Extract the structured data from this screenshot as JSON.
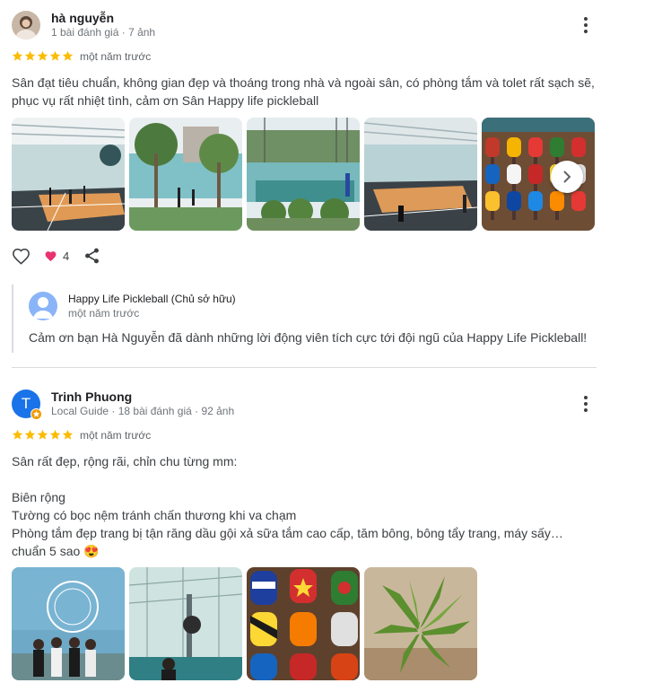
{
  "review1": {
    "author": "hà nguyễn",
    "meta": "1 bài đánh giá · 7 ảnh",
    "rating": 5,
    "time": "một năm trước",
    "text_line1": "Sân đạt tiêu chuẩn, không gian đẹp và thoáng trong nhà và ngoài sân, có phòng tắm và tolet rất sạch sẽ,",
    "text_line2": "phục vụ rất nhiệt tình, cảm ơn Sân Happy life pickleball",
    "like_count": "4",
    "owner_response": {
      "name": "Happy Life Pickleball (Chủ sở hữu)",
      "time": "một năm trước",
      "text": "Cảm ơn bạn Hà Nguyễn đã dành những lời động viên tích cực tới đội ngũ của Happy Life Pickleball!"
    }
  },
  "review2": {
    "avatar_letter": "T",
    "author": "Trinh Phuong",
    "meta": "Local Guide · 18 bài đánh giá · 92 ảnh",
    "rating": 5,
    "time": "một năm trước",
    "lines": [
      "Sân rất đẹp, rộng rãi, chỉn chu từng mm:",
      "",
      "Biên rộng",
      "Tường có bọc nệm tránh chấn thương khi va chạm",
      "Phòng tắm đẹp trang bị tận răng dầu gội xả sữa tắm cao cấp, tăm bông, bông tẩy trang, máy sấy…",
      "chuẩn 5 sao 😍"
    ]
  },
  "colors": {
    "star": "#fbbc04",
    "heart": "#e8336f",
    "avatar_blue": "#1a73e8",
    "owner_avatar": "#8ab4f8",
    "divider": "#dadce0"
  },
  "icons": {
    "more": "more-vert-icon",
    "like": "heart-outline-icon",
    "reaction": "heart-filled-icon",
    "share": "share-icon",
    "next": "chevron-right-icon"
  }
}
